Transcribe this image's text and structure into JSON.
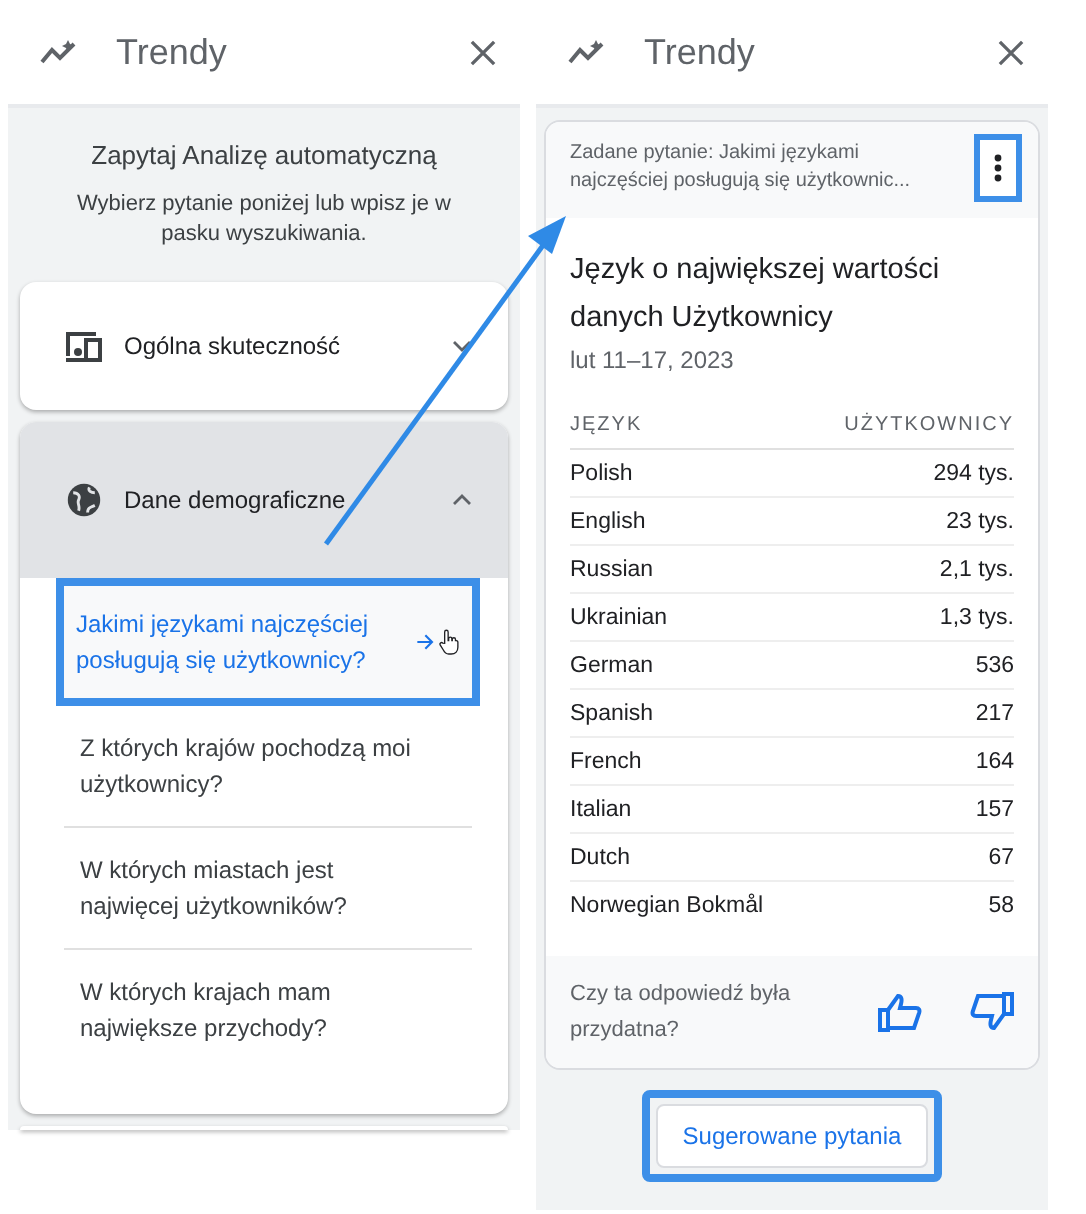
{
  "left_panel": {
    "title": "Trendy",
    "intro_title": "Zapytaj Analizę automatyczną",
    "intro_text": "Wybierz pytanie poniżej lub wpisz je w pasku wyszukiwania.",
    "sections": [
      {
        "kind": "devices",
        "label": "Ogólna skuteczność",
        "expanded": false
      },
      {
        "kind": "globe",
        "label": "Dane demograficzne",
        "expanded": true,
        "questions": [
          {
            "text": "Jakimi językami najczęściej posługują się użytkownicy?",
            "selected": true
          },
          {
            "text": "Z których krajów pochodzą moi użytkownicy?",
            "selected": false
          },
          {
            "text": "W których miastach jest najwięcej użytkowników?",
            "selected": false
          },
          {
            "text": "W których krajach mam największe przychody?",
            "selected": false
          }
        ]
      }
    ]
  },
  "right_panel": {
    "title": "Trendy",
    "asked_question": "Zadane pytanie: Jakimi językami najczęściej posługują się użytkownic...",
    "menu_highlighted": true,
    "answer_title": "Język o największej wartości danych Użytkownicy",
    "date_range": "lut 11–17, 2023",
    "table": {
      "columns": [
        "JĘZYK",
        "UŻYTKOWNICY"
      ],
      "rows": [
        [
          "Polish",
          "294 tys."
        ],
        [
          "English",
          "23 tys."
        ],
        [
          "Russian",
          "2,1 tys."
        ],
        [
          "Ukrainian",
          "1,3 tys."
        ],
        [
          "German",
          "536"
        ],
        [
          "Spanish",
          "217"
        ],
        [
          "French",
          "164"
        ],
        [
          "Italian",
          "157"
        ],
        [
          "Dutch",
          "67"
        ],
        [
          "Norwegian Bokmål",
          "58"
        ]
      ]
    },
    "feedback_question": "Czy ta odpowiedź była przydatna?",
    "suggest_button": {
      "label": "Sugerowane pytania",
      "highlighted": true
    }
  }
}
